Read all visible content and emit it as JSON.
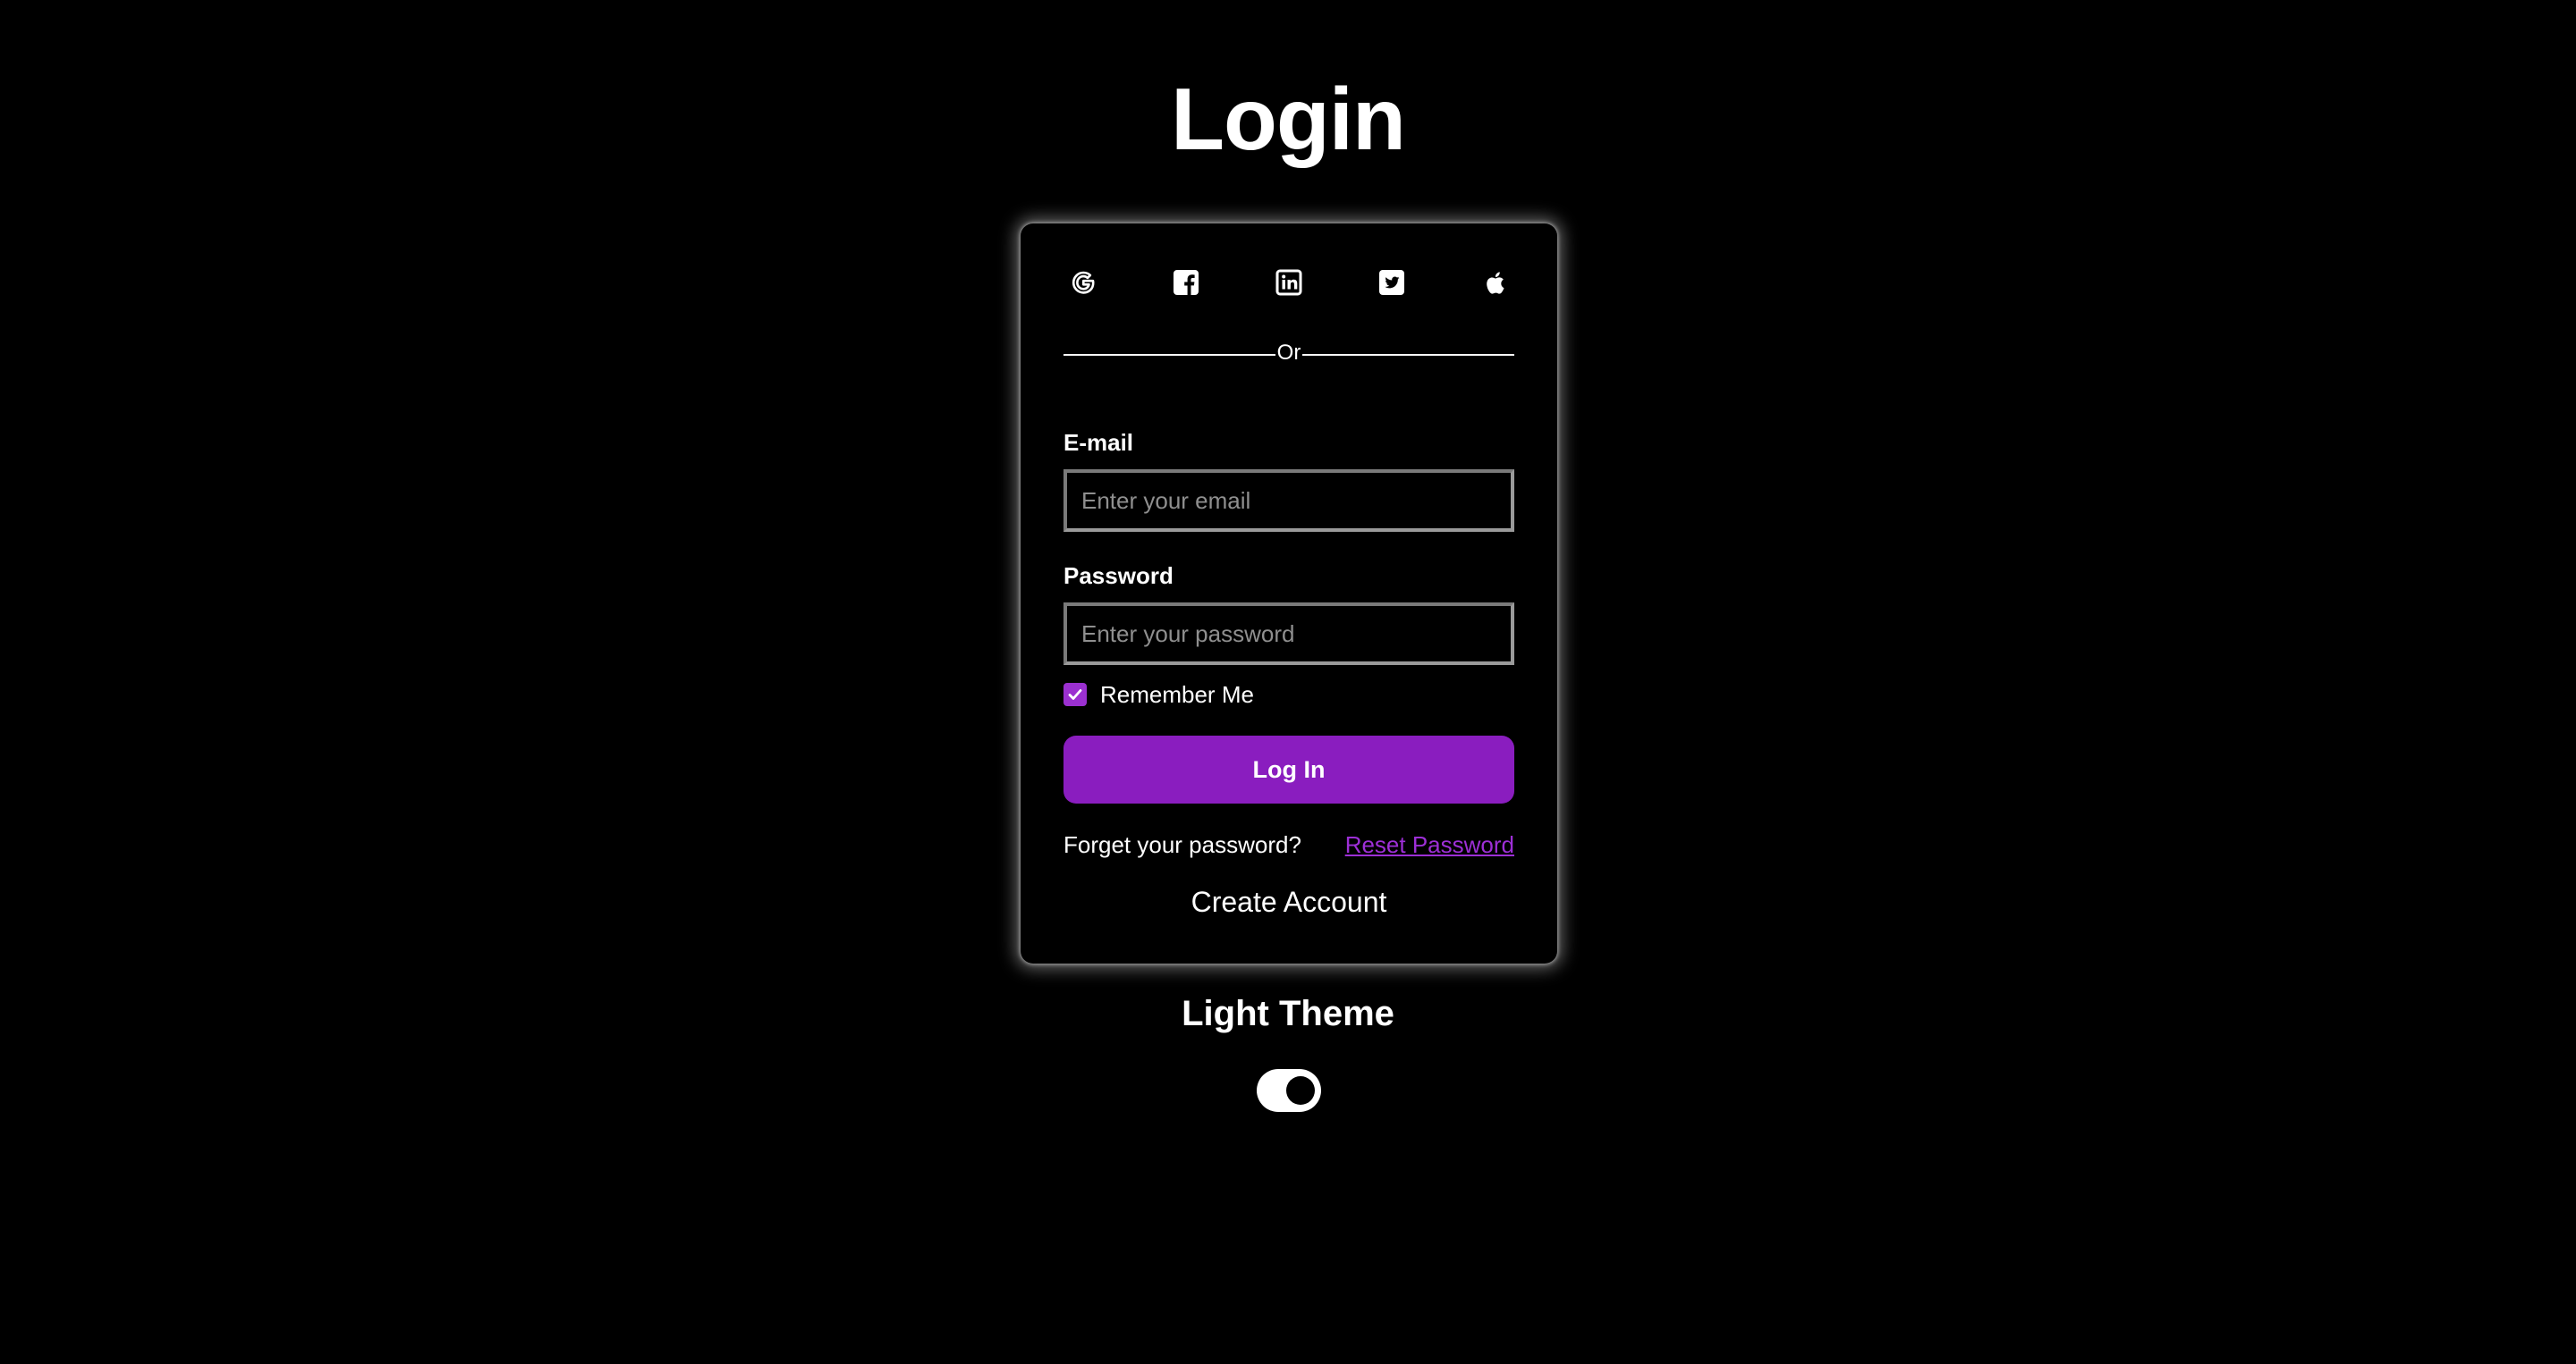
{
  "page": {
    "title": "Login"
  },
  "social": [
    {
      "name": "google",
      "icon": "google-icon"
    },
    {
      "name": "facebook",
      "icon": "facebook-icon"
    },
    {
      "name": "linkedin",
      "icon": "linkedin-icon"
    },
    {
      "name": "twitter",
      "icon": "twitter-icon"
    },
    {
      "name": "apple",
      "icon": "apple-icon"
    }
  ],
  "divider": {
    "text": "Or"
  },
  "form": {
    "email": {
      "label": "E-mail",
      "value": "",
      "placeholder": "Enter your email"
    },
    "password": {
      "label": "Password",
      "value": "",
      "placeholder": "Enter your password"
    },
    "remember": {
      "label": "Remember Me",
      "checked": true
    },
    "login_label": "Log In",
    "forgot_text": "Forget your password?",
    "reset_label": "Reset Password",
    "create_account_label": "Create Account"
  },
  "theme": {
    "title": "Light Theme",
    "toggle_on": true
  },
  "colors": {
    "background": "#000000",
    "accent": "#8a1dbf",
    "link": "#9d2fd6",
    "text": "#ffffff"
  }
}
